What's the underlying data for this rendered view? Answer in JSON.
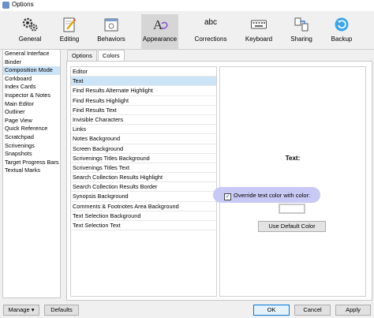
{
  "window": {
    "title": "Options"
  },
  "toolbar": {
    "items": [
      {
        "label": "General",
        "icon": "gear-icon"
      },
      {
        "label": "Editing",
        "icon": "pencil-icon"
      },
      {
        "label": "Behaviors",
        "icon": "window-icon"
      },
      {
        "label": "Appearance",
        "icon": "font-icon",
        "selected": true
      },
      {
        "label": "Corrections",
        "icon": "abc-icon"
      },
      {
        "label": "Keyboard",
        "icon": "keyboard-icon"
      },
      {
        "label": "Sharing",
        "icon": "share-icon"
      },
      {
        "label": "Backup",
        "icon": "backup-icon"
      }
    ],
    "corrections_glyph": "abc"
  },
  "sidebar": {
    "items": [
      "General Interface",
      "Binder",
      "Composition Mode",
      "Corkboard",
      "Index Cards",
      "Inspector & Notes",
      "Main Editor",
      "Outliner",
      "Page View",
      "Quick Reference",
      "Scratchpad",
      "Scrivenings",
      "Snapshots",
      "Target Progress Bars",
      "Textual Marks"
    ],
    "selected_index": 2
  },
  "tabs": [
    {
      "label": "Options"
    },
    {
      "label": "Colors",
      "active": true
    }
  ],
  "color_list": {
    "items": [
      "Editor",
      "Text",
      "Find Results Alternate Highlight",
      "Find Results Highlight",
      "Find Results Text",
      "Invisible Characters",
      "Links",
      "Notes Background",
      "Screen Background",
      "Scrivenings Titles Background",
      "Scrivenings Titles Text",
      "Search Collection Results Highlight",
      "Search Collection Results Border",
      "Synopsis Background",
      "Comments & Footnotes Area Background",
      "Text Selection Background",
      "Text Selection Text"
    ],
    "selected_index": 1
  },
  "preview": {
    "heading": "Text:",
    "override_label": "Override text color with color:",
    "override_checked": true,
    "check_glyph": "✓",
    "swatch_color": "#ffffff",
    "default_button": "Use Default Color"
  },
  "footer": {
    "manage_label": "Manage",
    "manage_arrow": "▾",
    "defaults_label": "Defaults",
    "ok_label": "OK",
    "cancel_label": "Cancel",
    "apply_label": "Apply"
  },
  "colors": {
    "selection": "#cce4f7",
    "highlight": "#c9c9f5",
    "accent": "#0078d7"
  }
}
